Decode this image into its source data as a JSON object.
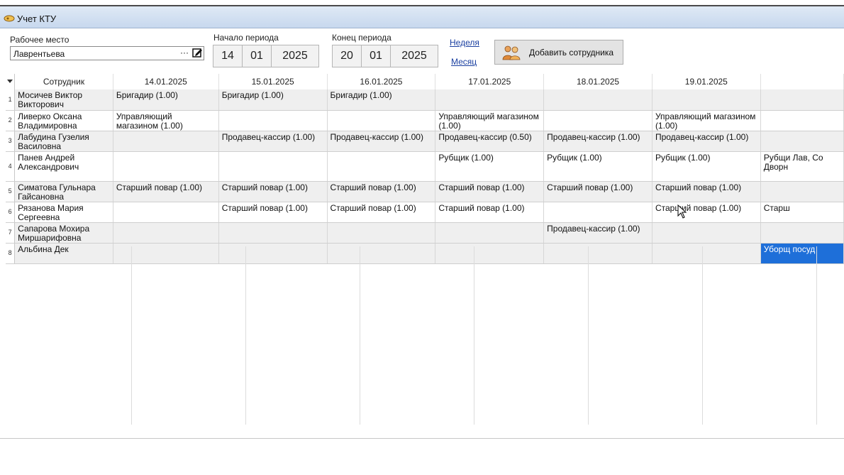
{
  "window": {
    "title": "Учет КТУ"
  },
  "filters": {
    "workplace_label": "Рабочее место",
    "workplace_value": "Лаврентьева",
    "browse_label": "···",
    "start_label": "Начало периода",
    "start_day": "14",
    "start_month": "01",
    "start_year": "2025",
    "end_label": "Конец периода",
    "end_day": "20",
    "end_month": "01",
    "end_year": "2025",
    "week_link": "Неделя",
    "month_link": "Месяц",
    "add_button": "Добавить сотрудника"
  },
  "grid": {
    "employee_header": "Сотрудник",
    "dates": [
      "14.01.2025",
      "15.01.2025",
      "16.01.2025",
      "17.01.2025",
      "18.01.2025",
      "19.01.2025",
      ""
    ],
    "rows": [
      {
        "n": "1",
        "name": "Мосичев Виктор Викторович",
        "cells": [
          "Бригадир (1.00)",
          "Бригадир (1.00)",
          "Бригадир (1.00)",
          "",
          "",
          "",
          ""
        ]
      },
      {
        "n": "2",
        "name": "Ливерко Оксана Владимировна",
        "cells": [
          "Управляющий магазином (1.00)",
          "",
          "",
          "Управляющий магазином (1.00)",
          "",
          "Управляющий магазином (1.00)",
          ""
        ]
      },
      {
        "n": "3",
        "name": "Лабудина Гузелия Василовна",
        "cells": [
          "",
          "Продавец-кассир (1.00)",
          "Продавец-кассир (1.00)",
          "Продавец-кассир (0.50)",
          "Продавец-кассир (1.00)",
          "Продавец-кассир (1.00)",
          ""
        ]
      },
      {
        "n": "4",
        "name": "Панев Андрей Александрович",
        "cells": [
          "",
          "",
          "",
          "Рубщик (1.00)",
          "Рубщик (1.00)",
          "Рубщик (1.00)",
          "Рубщи Лав, Со Дворн"
        ]
      },
      {
        "n": "5",
        "name": "Симатова Гульнара Гайсановна",
        "cells": [
          "Старший повар (1.00)",
          "Старший повар (1.00)",
          "Старший повар (1.00)",
          "Старший повар (1.00)",
          "Старший повар (1.00)",
          "Старший повар (1.00)",
          ""
        ]
      },
      {
        "n": "6",
        "name": "Рязанова Мария Сергеевна",
        "cells": [
          "",
          "Старший повар (1.00)",
          "Старший повар (1.00)",
          "Старший повар (1.00)",
          "",
          "Старший повар (1.00)",
          "Старш"
        ]
      },
      {
        "n": "7",
        "name": "Сапарова Мохира Миршарифовна",
        "cells": [
          "",
          "",
          "",
          "",
          "Продавец-кассир (1.00)",
          "",
          ""
        ]
      },
      {
        "n": "8",
        "name": "Альбина Дек",
        "cells": [
          "",
          "",
          "",
          "",
          "",
          "",
          "Уборщ посуд"
        ]
      }
    ]
  },
  "colors": {
    "selection": "#1e6fd9",
    "link": "#1a3fa0",
    "titlebar": "#c7d8ee"
  }
}
